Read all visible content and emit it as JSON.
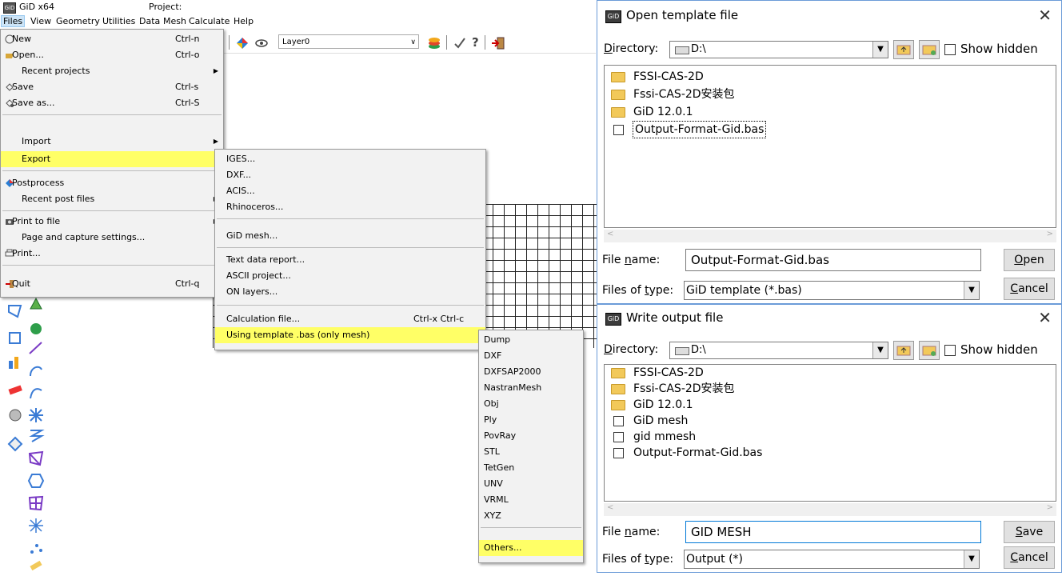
{
  "gid": {
    "title": "GiD x64",
    "project_label": "Project:",
    "menubar": [
      "Files",
      "View",
      "Geometry",
      "Utilities",
      "Data",
      "Mesh",
      "Calculate",
      "Help"
    ],
    "layer": "Layer0",
    "files_menu": [
      {
        "label": "New",
        "shortcut": "Ctrl-n",
        "icon": "new-icon"
      },
      {
        "label": "Open...",
        "shortcut": "Ctrl-o",
        "icon": "open-icon"
      },
      {
        "label": "Recent projects",
        "submenu": true
      },
      {
        "label": "Save",
        "shortcut": "Ctrl-s",
        "icon": "save-icon"
      },
      {
        "label": "Save as...",
        "shortcut": "Ctrl-S",
        "icon": "save-as-icon"
      },
      {
        "label": "Import",
        "submenu": true
      },
      {
        "label": "Export",
        "highlighted": true
      },
      {
        "label": "Postprocess",
        "icon": "postprocess-icon"
      },
      {
        "label": "Recent post files",
        "submenu": true
      },
      {
        "label": "Print to file",
        "submenu": true,
        "icon": "print-to-file-icon"
      },
      {
        "label": "Page and capture settings..."
      },
      {
        "label": "Print...",
        "icon": "print-icon"
      },
      {
        "label": "Quit",
        "shortcut": "Ctrl-q",
        "icon": "quit-icon"
      }
    ],
    "export_menu": [
      {
        "label": "IGES..."
      },
      {
        "label": "DXF..."
      },
      {
        "label": "ACIS..."
      },
      {
        "label": "Rhinoceros..."
      },
      {
        "label": "GiD mesh..."
      },
      {
        "label": "Text data report..."
      },
      {
        "label": "ASCII project..."
      },
      {
        "label": "ON layers..."
      },
      {
        "label": "Calculation file...",
        "shortcut": "Ctrl-x Ctrl-c"
      },
      {
        "label": "Using template .bas (only mesh)",
        "highlighted": true
      }
    ],
    "template_menu": [
      "Dump",
      "DXF",
      "DXFSAP2000",
      "NastranMesh",
      "Obj",
      "Ply",
      "PovRay",
      "STL",
      "TetGen",
      "UNV",
      "VRML",
      "XYZ",
      "Others..."
    ]
  },
  "open_dialog": {
    "title": "Open template file",
    "directory_label": "Directory:",
    "directory": "D:\\",
    "show_hidden": "Show hidden",
    "files": [
      {
        "name": "FSSI-CAS-2D",
        "type": "folder"
      },
      {
        "name": "Fssi-CAS-2D安装包",
        "type": "folder"
      },
      {
        "name": "GiD 12.0.1",
        "type": "folder"
      },
      {
        "name": "Output-Format-Gid.bas",
        "type": "file",
        "selected": true
      }
    ],
    "file_name_label": "File name:",
    "file_name": "Output-Format-Gid.bas",
    "file_type_label": "Files of type:",
    "file_type": "GiD template (*.bas)",
    "ok_button": "Open",
    "cancel_button": "Cancel"
  },
  "write_dialog": {
    "title": "Write output file",
    "directory_label": "Directory:",
    "directory": "D:\\",
    "show_hidden": "Show hidden",
    "files": [
      {
        "name": "FSSI-CAS-2D",
        "type": "folder"
      },
      {
        "name": "Fssi-CAS-2D安装包",
        "type": "folder"
      },
      {
        "name": "GiD 12.0.1",
        "type": "folder"
      },
      {
        "name": "GiD mesh",
        "type": "file"
      },
      {
        "name": "gid mmesh",
        "type": "file"
      },
      {
        "name": "Output-Format-Gid.bas",
        "type": "file"
      }
    ],
    "file_name_label": "File name:",
    "file_name": "GID MESH",
    "file_type_label": "Files of type:",
    "file_type": "Output (*)",
    "ok_button": "Save",
    "cancel_button": "Cancel"
  }
}
